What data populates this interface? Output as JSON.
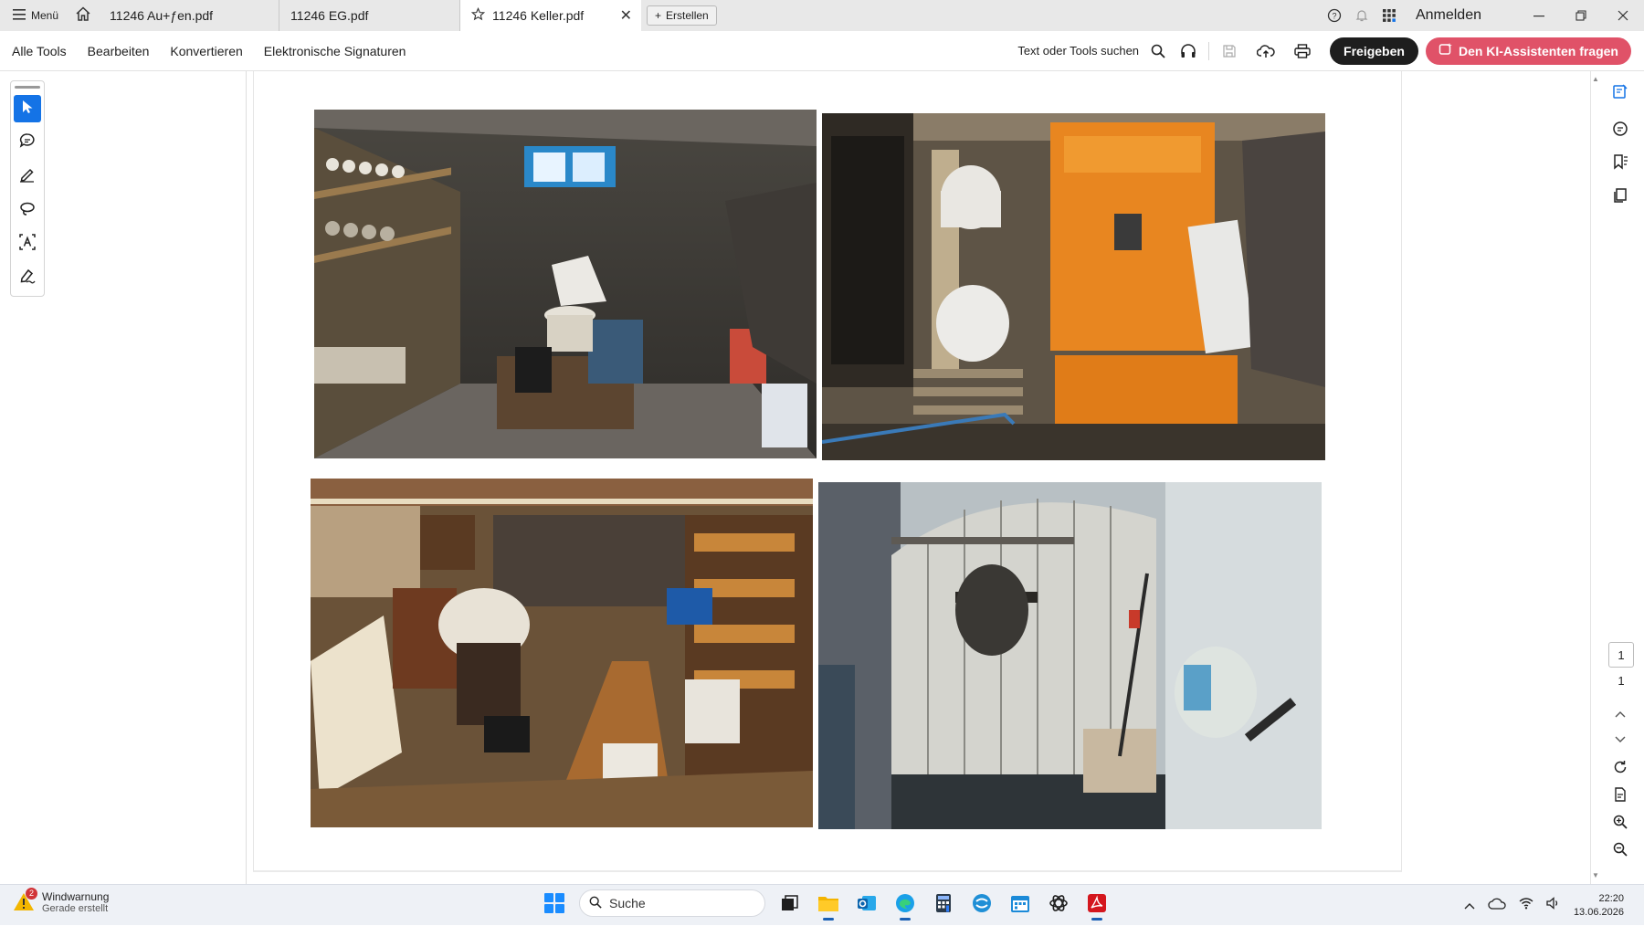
{
  "tabbar": {
    "menu_label": "Menü",
    "tabs": [
      {
        "label": "11246 Au+ƒen.pdf"
      },
      {
        "label": "11246 EG.pdf"
      },
      {
        "label": "11246 Keller.pdf"
      }
    ],
    "new_tab_label": "Erstellen",
    "signin_label": "Anmelden"
  },
  "toolbar": {
    "menu": [
      "Alle Tools",
      "Bearbeiten",
      "Konvertieren",
      "Elektronische Signaturen"
    ],
    "search_label": "Text oder Tools suchen",
    "share_label": "Freigeben",
    "ai_label": "Den KI-Assistenten fragen"
  },
  "left_tools": [
    "select-tool",
    "comment-tool",
    "highlight-tool",
    "draw-tool",
    "text-recognition-tool",
    "sign-tool"
  ],
  "page_nav": {
    "current_page": "1",
    "total_pages": "1"
  },
  "taskbar": {
    "notification_title": "Windwarnung",
    "notification_sub": "Gerade erstellt",
    "notification_badge": "2",
    "search_label": "Suche",
    "time": "22:20",
    "date": "13.06.2026"
  },
  "colors": {
    "accent_blue": "#1473e6",
    "ai_button": "#e05268",
    "share_button": "#1e1e1e"
  }
}
